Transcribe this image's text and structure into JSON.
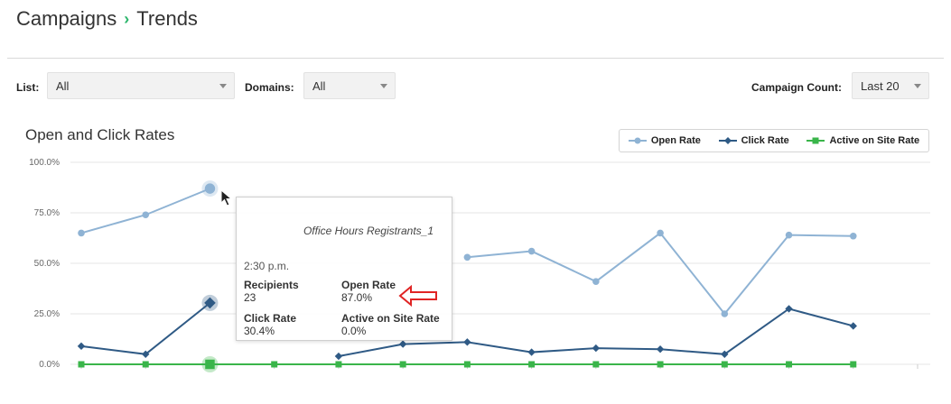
{
  "breadcrumb": {
    "parent": "Campaigns",
    "separator": "›",
    "current": "Trends"
  },
  "filters": {
    "list": {
      "label": "List:",
      "value": "All"
    },
    "domains": {
      "label": "Domains:",
      "value": "All"
    },
    "campaign_count": {
      "label": "Campaign Count:",
      "value": "Last 20"
    }
  },
  "colors": {
    "open_rate": "#8fb3d4",
    "click_rate": "#2f5a85",
    "active_rate": "#3ab54a",
    "accent": "#2cb66b"
  },
  "tooltip": {
    "name": "Office Hours Registrants_1",
    "time": "2:30 p.m.",
    "recipients_label": "Recipients",
    "recipients_value": "23",
    "open_label": "Open Rate",
    "open_value": "87.0%",
    "click_label": "Click Rate",
    "click_value": "30.4%",
    "active_label": "Active on Site Rate",
    "active_value": "0.0%"
  },
  "chart_data": {
    "type": "line",
    "title": "Open and Click Rates",
    "xlabel": "",
    "ylabel": "",
    "ylim": [
      0,
      100
    ],
    "yticks": [
      "100.0%",
      "75.0%",
      "50.0%",
      "25.0%",
      "0.0%"
    ],
    "grid": true,
    "legend": "top-right",
    "x": [
      1,
      2,
      3,
      4,
      5,
      6,
      7,
      8,
      9,
      10,
      11,
      12,
      13,
      14
    ],
    "highlighted_index": 2,
    "series": [
      {
        "name": "Open Rate",
        "marker": "circle",
        "values": [
          65,
          74,
          87,
          null,
          null,
          null,
          53,
          56,
          41,
          65,
          25,
          64,
          63.5
        ]
      },
      {
        "name": "Click Rate",
        "marker": "diamond",
        "values": [
          9,
          5,
          30.4,
          null,
          4,
          10,
          11,
          6,
          8,
          7.5,
          5,
          27.5,
          19
        ]
      },
      {
        "name": "Active on Site Rate",
        "marker": "square",
        "values": [
          0,
          0,
          0,
          0,
          0,
          0,
          0,
          0,
          0,
          0,
          0,
          0,
          0
        ]
      }
    ]
  }
}
